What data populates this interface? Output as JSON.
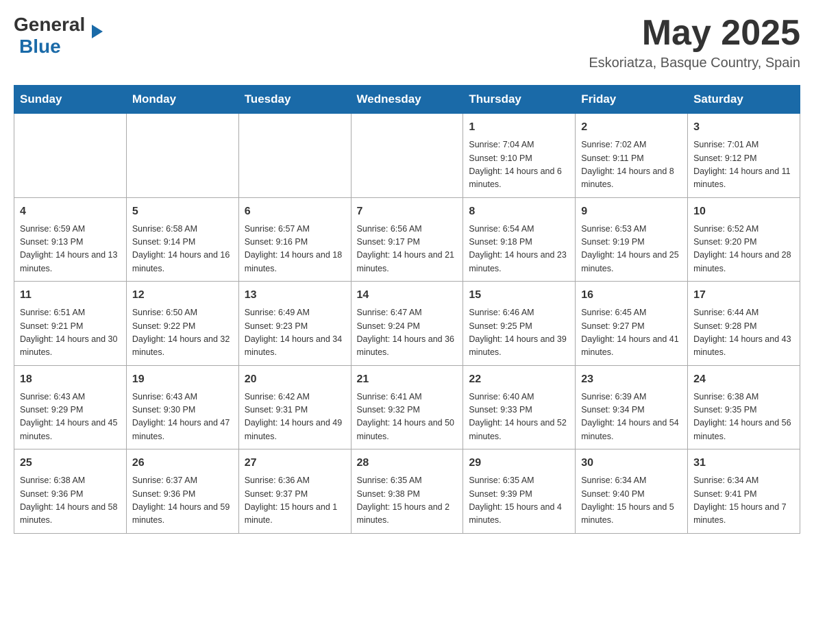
{
  "header": {
    "logo": {
      "general": "General",
      "blue": "Blue"
    },
    "title": "May 2025",
    "location": "Eskoriatza, Basque Country, Spain"
  },
  "calendar": {
    "days_of_week": [
      "Sunday",
      "Monday",
      "Tuesday",
      "Wednesday",
      "Thursday",
      "Friday",
      "Saturday"
    ],
    "weeks": [
      [
        {
          "day": "",
          "info": ""
        },
        {
          "day": "",
          "info": ""
        },
        {
          "day": "",
          "info": ""
        },
        {
          "day": "",
          "info": ""
        },
        {
          "day": "1",
          "info": "Sunrise: 7:04 AM\nSunset: 9:10 PM\nDaylight: 14 hours and 6 minutes."
        },
        {
          "day": "2",
          "info": "Sunrise: 7:02 AM\nSunset: 9:11 PM\nDaylight: 14 hours and 8 minutes."
        },
        {
          "day": "3",
          "info": "Sunrise: 7:01 AM\nSunset: 9:12 PM\nDaylight: 14 hours and 11 minutes."
        }
      ],
      [
        {
          "day": "4",
          "info": "Sunrise: 6:59 AM\nSunset: 9:13 PM\nDaylight: 14 hours and 13 minutes."
        },
        {
          "day": "5",
          "info": "Sunrise: 6:58 AM\nSunset: 9:14 PM\nDaylight: 14 hours and 16 minutes."
        },
        {
          "day": "6",
          "info": "Sunrise: 6:57 AM\nSunset: 9:16 PM\nDaylight: 14 hours and 18 minutes."
        },
        {
          "day": "7",
          "info": "Sunrise: 6:56 AM\nSunset: 9:17 PM\nDaylight: 14 hours and 21 minutes."
        },
        {
          "day": "8",
          "info": "Sunrise: 6:54 AM\nSunset: 9:18 PM\nDaylight: 14 hours and 23 minutes."
        },
        {
          "day": "9",
          "info": "Sunrise: 6:53 AM\nSunset: 9:19 PM\nDaylight: 14 hours and 25 minutes."
        },
        {
          "day": "10",
          "info": "Sunrise: 6:52 AM\nSunset: 9:20 PM\nDaylight: 14 hours and 28 minutes."
        }
      ],
      [
        {
          "day": "11",
          "info": "Sunrise: 6:51 AM\nSunset: 9:21 PM\nDaylight: 14 hours and 30 minutes."
        },
        {
          "day": "12",
          "info": "Sunrise: 6:50 AM\nSunset: 9:22 PM\nDaylight: 14 hours and 32 minutes."
        },
        {
          "day": "13",
          "info": "Sunrise: 6:49 AM\nSunset: 9:23 PM\nDaylight: 14 hours and 34 minutes."
        },
        {
          "day": "14",
          "info": "Sunrise: 6:47 AM\nSunset: 9:24 PM\nDaylight: 14 hours and 36 minutes."
        },
        {
          "day": "15",
          "info": "Sunrise: 6:46 AM\nSunset: 9:25 PM\nDaylight: 14 hours and 39 minutes."
        },
        {
          "day": "16",
          "info": "Sunrise: 6:45 AM\nSunset: 9:27 PM\nDaylight: 14 hours and 41 minutes."
        },
        {
          "day": "17",
          "info": "Sunrise: 6:44 AM\nSunset: 9:28 PM\nDaylight: 14 hours and 43 minutes."
        }
      ],
      [
        {
          "day": "18",
          "info": "Sunrise: 6:43 AM\nSunset: 9:29 PM\nDaylight: 14 hours and 45 minutes."
        },
        {
          "day": "19",
          "info": "Sunrise: 6:43 AM\nSunset: 9:30 PM\nDaylight: 14 hours and 47 minutes."
        },
        {
          "day": "20",
          "info": "Sunrise: 6:42 AM\nSunset: 9:31 PM\nDaylight: 14 hours and 49 minutes."
        },
        {
          "day": "21",
          "info": "Sunrise: 6:41 AM\nSunset: 9:32 PM\nDaylight: 14 hours and 50 minutes."
        },
        {
          "day": "22",
          "info": "Sunrise: 6:40 AM\nSunset: 9:33 PM\nDaylight: 14 hours and 52 minutes."
        },
        {
          "day": "23",
          "info": "Sunrise: 6:39 AM\nSunset: 9:34 PM\nDaylight: 14 hours and 54 minutes."
        },
        {
          "day": "24",
          "info": "Sunrise: 6:38 AM\nSunset: 9:35 PM\nDaylight: 14 hours and 56 minutes."
        }
      ],
      [
        {
          "day": "25",
          "info": "Sunrise: 6:38 AM\nSunset: 9:36 PM\nDaylight: 14 hours and 58 minutes."
        },
        {
          "day": "26",
          "info": "Sunrise: 6:37 AM\nSunset: 9:36 PM\nDaylight: 14 hours and 59 minutes."
        },
        {
          "day": "27",
          "info": "Sunrise: 6:36 AM\nSunset: 9:37 PM\nDaylight: 15 hours and 1 minute."
        },
        {
          "day": "28",
          "info": "Sunrise: 6:35 AM\nSunset: 9:38 PM\nDaylight: 15 hours and 2 minutes."
        },
        {
          "day": "29",
          "info": "Sunrise: 6:35 AM\nSunset: 9:39 PM\nDaylight: 15 hours and 4 minutes."
        },
        {
          "day": "30",
          "info": "Sunrise: 6:34 AM\nSunset: 9:40 PM\nDaylight: 15 hours and 5 minutes."
        },
        {
          "day": "31",
          "info": "Sunrise: 6:34 AM\nSunset: 9:41 PM\nDaylight: 15 hours and 7 minutes."
        }
      ]
    ]
  }
}
